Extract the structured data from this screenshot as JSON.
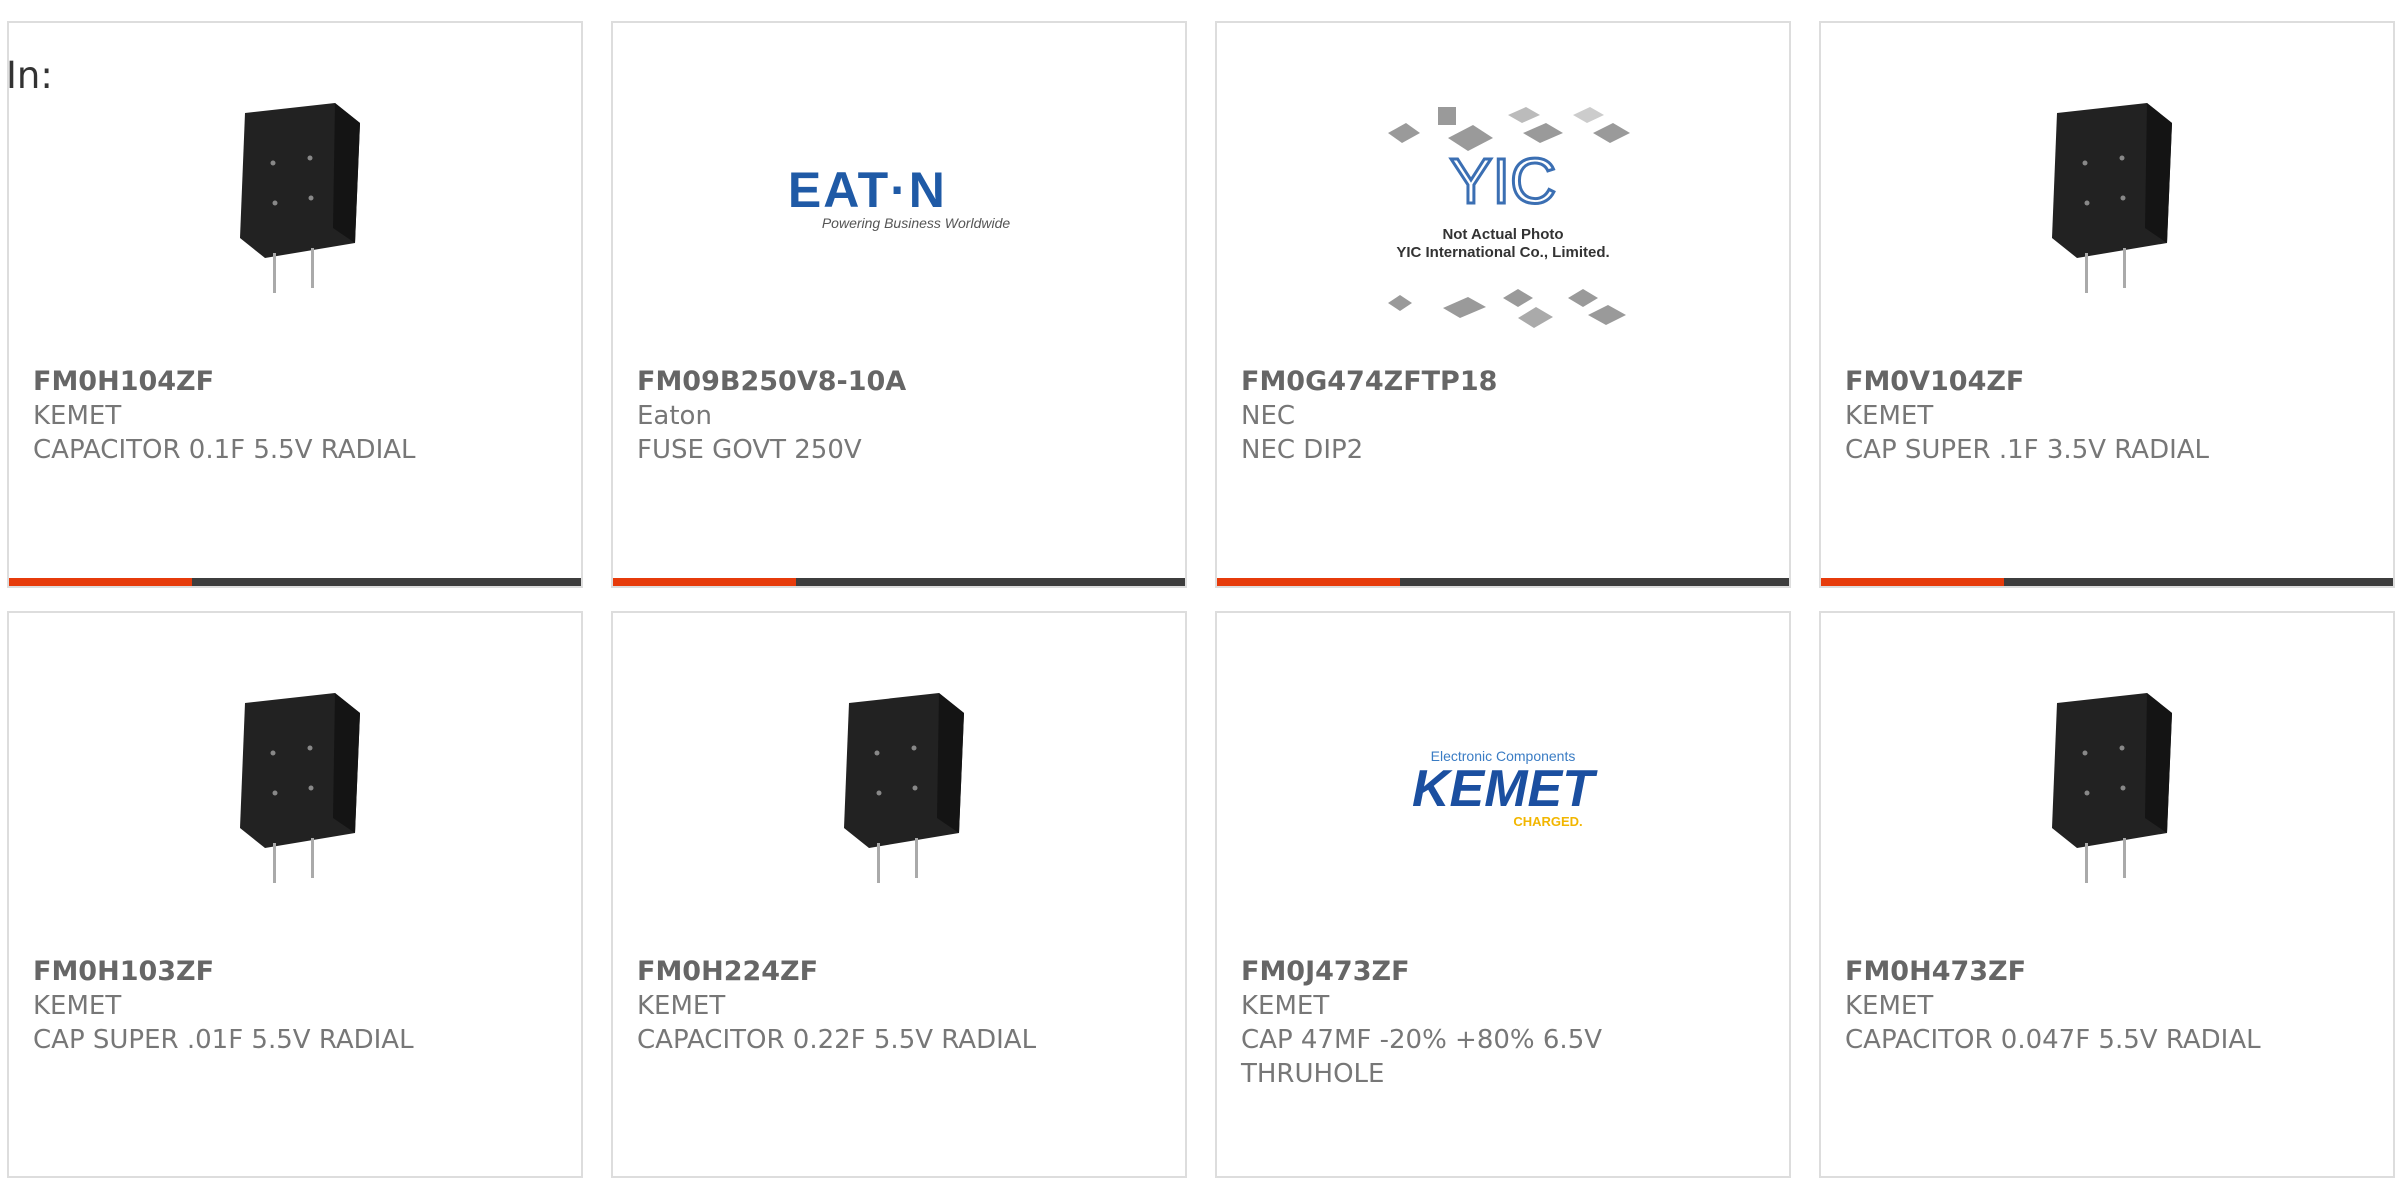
{
  "filter_label": "In:",
  "products": [
    {
      "part": "FM0H104ZF",
      "manufacturer": "KEMET",
      "description": "CAPACITOR 0.1F 5.5V RADIAL",
      "image": "capacitor-photo"
    },
    {
      "part": "FM09B250V8-10A",
      "manufacturer": "Eaton",
      "description": "FUSE GOVT 250V",
      "image": "eaton-logo",
      "logo_text": "EAT·N",
      "logo_tagline": "Powering Business Worldwide"
    },
    {
      "part": "FM0G474ZFTP18",
      "manufacturer": "NEC",
      "description": "NEC DIP2",
      "image": "yic-placeholder",
      "logo_text": "YIC",
      "note_line1": "Not Actual Photo",
      "note_line2": "YIC International Co., Limited."
    },
    {
      "part": "FM0V104ZF",
      "manufacturer": "KEMET",
      "description": "CAP SUPER .1F 3.5V RADIAL",
      "image": "capacitor-photo"
    },
    {
      "part": "FM0H103ZF",
      "manufacturer": "KEMET",
      "description": "CAP SUPER .01F 5.5V RADIAL",
      "image": "capacitor-photo"
    },
    {
      "part": "FM0H224ZF",
      "manufacturer": "KEMET",
      "description": "CAPACITOR 0.22F 5.5V RADIAL",
      "image": "capacitor-photo"
    },
    {
      "part": "FM0J473ZF",
      "manufacturer": "KEMET",
      "description": "CAP 47MF -20% +80% 6.5V THRUHOLE",
      "image": "kemet-logo",
      "logo_top": "Electronic Components",
      "logo_text": "KEMET",
      "logo_bottom": "CHARGED."
    },
    {
      "part": "FM0H473ZF",
      "manufacturer": "KEMET",
      "description": "CAPACITOR 0.047F 5.5V RADIAL",
      "image": "capacitor-photo"
    }
  ],
  "colors": {
    "accent": "#e63b0b",
    "bar": "#3d3d3d",
    "eaton_blue": "#1f5aa6",
    "kemet_blue": "#1b4fa0",
    "kemet_yellow": "#f2b600"
  }
}
